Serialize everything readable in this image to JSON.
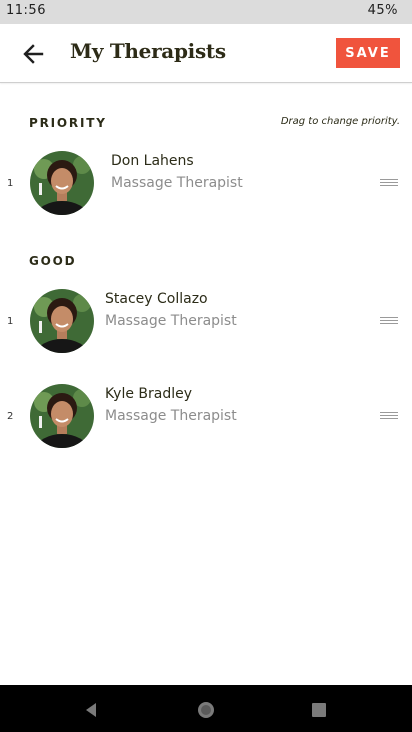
{
  "status": {
    "time": "11:56",
    "battery": "45%"
  },
  "header": {
    "title": "My Therapists",
    "save_label": "SAVE",
    "back_icon": "arrow-left-icon"
  },
  "sections": {
    "priority": {
      "label": "PRIORITY",
      "hint": "Drag to change priority."
    },
    "good": {
      "label": "GOOD"
    }
  },
  "therapists": [
    {
      "rank": "1",
      "name": "Don Lahens",
      "role": "Massage Therapist",
      "section": "priority"
    },
    {
      "rank": "1",
      "name": "Stacey Collazo",
      "role": "Massage Therapist",
      "section": "good"
    },
    {
      "rank": "2",
      "name": "Kyle Bradley",
      "role": "Massage Therapist",
      "section": "good"
    }
  ],
  "nav": {
    "back": "nav-back-icon",
    "home": "nav-home-icon",
    "recents": "nav-recents-icon"
  },
  "colors": {
    "accent": "#f0543d",
    "title": "#2d2b17",
    "role_text": "#8c8c8c"
  }
}
